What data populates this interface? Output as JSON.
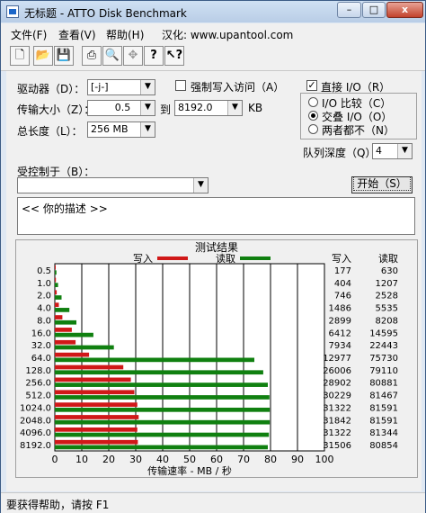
{
  "window": {
    "title": "无标题 - ATTO Disk Benchmark",
    "buttons": {
      "minimize": "–",
      "maximize": "□",
      "close": "x"
    }
  },
  "menu": [
    "文件(F)",
    "查看(V)",
    "帮助(H)",
    "汉化: www.upantool.com"
  ],
  "toolbar": [
    "new-icon",
    "open-icon",
    "save-icon",
    "print-icon",
    "print-preview-icon",
    "move-icon",
    "help-icon",
    "context-help-icon"
  ],
  "drive": {
    "label": "驱动器（D）：",
    "value": "[-j-]"
  },
  "transfer": {
    "label": "传输大小（Z）：",
    "from": "0.5",
    "to_label": "到",
    "to": "8192.0",
    "unit": "KB"
  },
  "total": {
    "label": "总长度（L）：",
    "value": "256 MB"
  },
  "force_write": {
    "label": "强制写入访问（A）",
    "checked": false
  },
  "direct_io": {
    "label": "直接 I/O（R）",
    "checked": true
  },
  "io_mode": {
    "options": [
      "I/O 比较（C）",
      "交叠 I/O（O）",
      "两者都不（N）"
    ],
    "selected": 1
  },
  "queue": {
    "label": "队列深度（Q）：",
    "value": "4"
  },
  "controlled_by": {
    "label": "受控制于（B）：",
    "value": ""
  },
  "start_button": "开始（S）",
  "description": "<<  你的描述  >>",
  "results_title": "测试结果",
  "legend": {
    "write": "写入",
    "read": "读取"
  },
  "columns": {
    "write": "写入",
    "read": "读取"
  },
  "colors": {
    "write": "#d01818",
    "read": "#108010"
  },
  "chart_data": {
    "type": "bar",
    "orientation": "horizontal",
    "title": "测试结果",
    "xlabel": "传输速率 - MB / 秒",
    "xlim": [
      0,
      100
    ],
    "xticks": [
      0,
      10,
      20,
      30,
      40,
      50,
      60,
      70,
      80,
      90,
      100
    ],
    "categories": [
      "0.5",
      "1.0",
      "2.0",
      "4.0",
      "8.0",
      "16.0",
      "32.0",
      "64.0",
      "128.0",
      "256.0",
      "512.0",
      "1024.0",
      "2048.0",
      "4096.0",
      "8192.0"
    ],
    "series": [
      {
        "name": "写入",
        "values": [
          0.2,
          0.4,
          0.7,
          1.5,
          2.8,
          6.3,
          7.7,
          12.7,
          25.4,
          28.2,
          29.5,
          30.6,
          31.1,
          30.6,
          30.8
        ]
      },
      {
        "name": "读取",
        "values": [
          0.6,
          1.2,
          2.5,
          5.4,
          8.0,
          14.3,
          21.9,
          74.0,
          77.3,
          79.0,
          79.6,
          79.7,
          79.7,
          79.4,
          79.0
        ]
      }
    ],
    "table": {
      "write": [
        "177",
        "404",
        "746",
        "1486",
        "2899",
        "6412",
        "7934",
        "12977",
        "26006",
        "28902",
        "30229",
        "31322",
        "31842",
        "31322",
        "31506"
      ],
      "read": [
        "630",
        "1207",
        "2528",
        "5535",
        "8208",
        "14595",
        "22443",
        "75730",
        "79110",
        "80881",
        "81467",
        "81591",
        "81591",
        "81344",
        "80854"
      ]
    },
    "grid": true,
    "legend_position": "top"
  },
  "status": "要获得帮助，请按 F1"
}
